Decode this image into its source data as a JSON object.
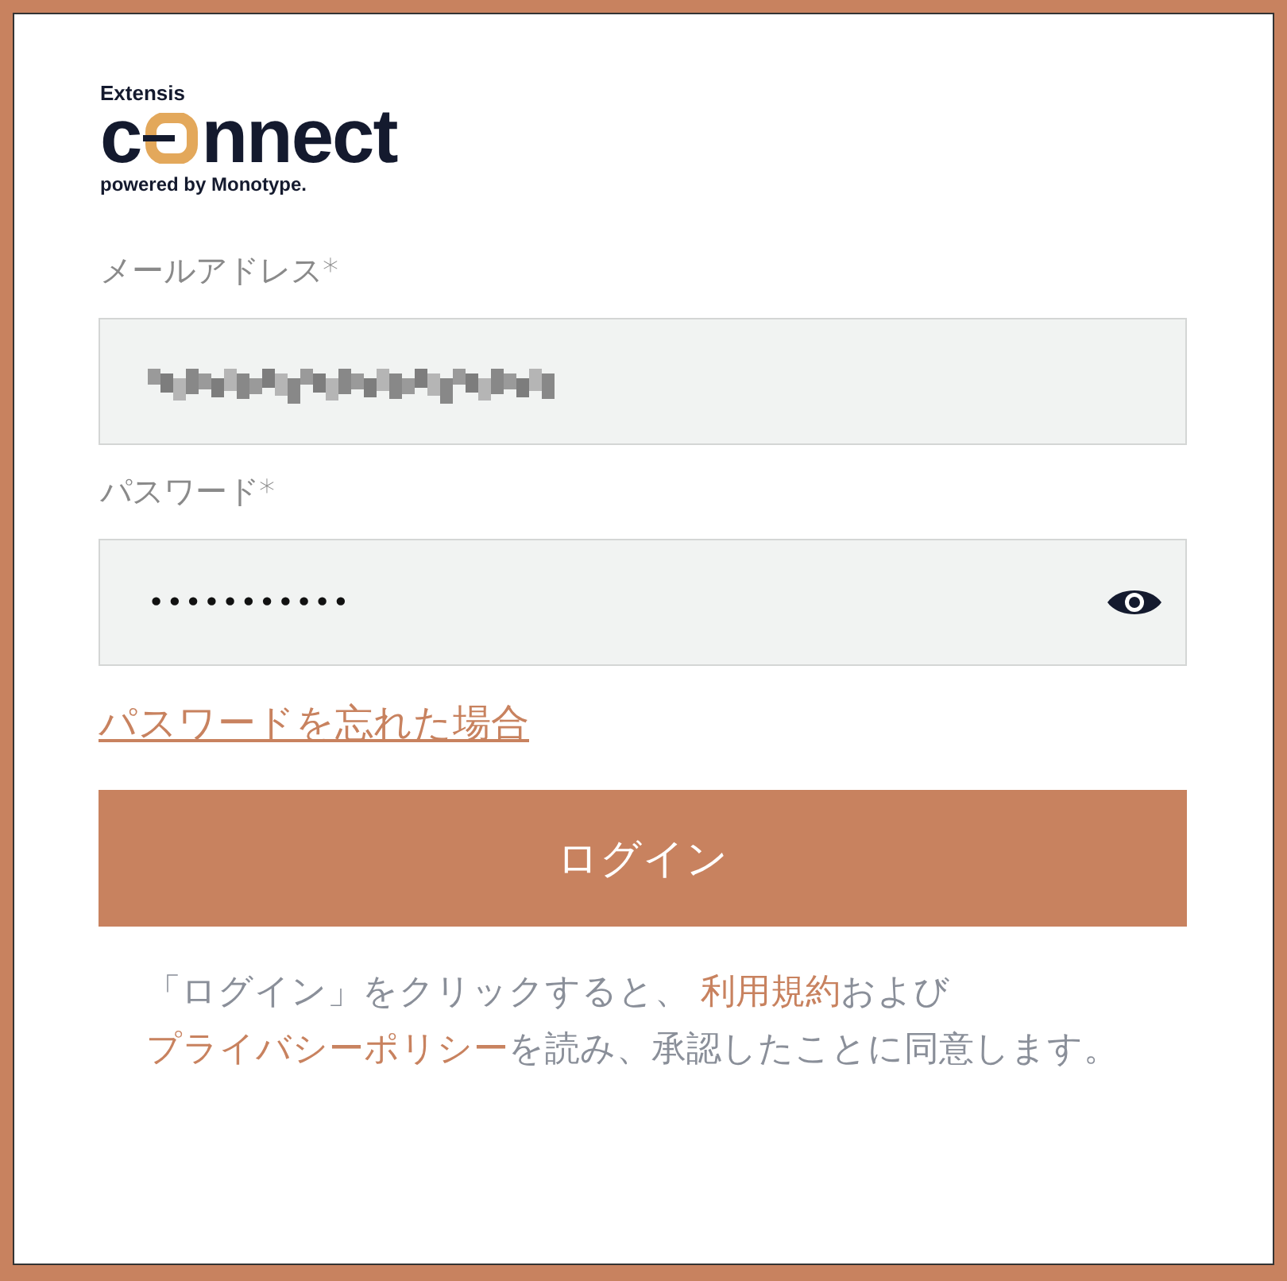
{
  "logo": {
    "brand": "Extensis",
    "word_start": "c",
    "word_end": "nnect",
    "tagline": "powered by Monotype."
  },
  "email": {
    "label": "メールアドレス*",
    "redacted": true
  },
  "password": {
    "label": "パスワード*",
    "value": "•••••••••••"
  },
  "forgot_link": "パスワードを忘れた場合",
  "login_button": "ログイン",
  "legal": [
    {
      "kind": "text",
      "text": "「ログイン」をクリックすると、 "
    },
    {
      "kind": "link",
      "text": "利用規約"
    },
    {
      "kind": "text",
      "text": "および"
    },
    {
      "kind": "link",
      "text": "プライバシーポリシー"
    },
    {
      "kind": "text",
      "text": "を読み、承認したことに同意します。"
    }
  ]
}
